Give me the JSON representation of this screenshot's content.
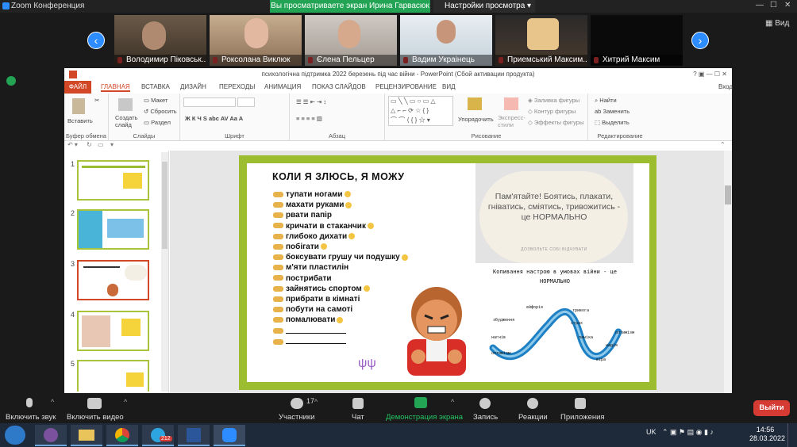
{
  "zoom_title": "Zoom Конференция",
  "share_banner": "Вы просматриваете экран Ирина Гарвасюк",
  "view_options": "Настройки просмотра",
  "view_toggle": "Вид",
  "participants": [
    {
      "name": "Володимир Піковськ..."
    },
    {
      "name": "Роксолана Виклюк"
    },
    {
      "name": "Єлена Пельцер"
    },
    {
      "name": "Вадим Украінець"
    },
    {
      "name": "Приемський Максим..."
    },
    {
      "name": "Хитрий Максим"
    }
  ],
  "ppt": {
    "title": "психологічна підтримка 2022 березень під час війни - PowerPoint (Сбой активации продукта)",
    "tabs": [
      "ФАЙЛ",
      "ГЛАВНАЯ",
      "ВСТАВКА",
      "ДИЗАЙН",
      "ПЕРЕХОДЫ",
      "АНИМАЦИЯ",
      "ПОКАЗ СЛАЙДОВ",
      "РЕЦЕНЗИРОВАНИЕ",
      "ВИД"
    ],
    "signin": "Вход",
    "ribbon": {
      "paste": "Вставить",
      "clipboard": "Буфер обмена",
      "new_slide": "Создать слайд",
      "layout": "Макет",
      "reset": "Сбросить",
      "section": "Раздел",
      "slides": "Слайды",
      "font": "Шрифт",
      "paragraph": "Абзац",
      "arrange": "Упорядочить",
      "quick_styles": "Экспресс-стили",
      "drawing": "Рисование",
      "fill": "Заливка фигуры",
      "outline": "Контур фигуры",
      "effects": "Эффекты фигуры",
      "find": "Найти",
      "replace": "Заменить",
      "select": "Выделить",
      "editing": "Редактирование"
    },
    "slide_numbers": [
      "1",
      "2",
      "3",
      "4",
      "5"
    ],
    "slide": {
      "heading": "КОЛИ Я ЗЛЮСЬ, Я МОЖУ",
      "items": [
        "тупати ногами",
        "махати руками",
        "рвати папір",
        "кричати в стаканчик",
        "глибоко дихати",
        "побігати",
        "боксувати грушу чи подушку",
        "м'яти пластилін",
        "пострибати",
        "зайнятись спортом",
        "прибрати в кімнаті",
        "побути на самоті",
        "помалювати",
        "",
        ""
      ],
      "remember": "Пам'ятайте! Боятись, плакати, гніватись, сміятись, тривожитись - це НОРМАЛЬНО",
      "allow": "ДОЗВОЛЬТЕ СОБІ ВІДЧУВАТИ",
      "copy": "Копивання настрою в умовах війни - це НОРМАЛЬНО",
      "wave_labels": [
        "ейфорія",
        "тривога",
        "збудження",
        "страх",
        "нагнів",
        "паніка",
        "оптимізм",
        "оптимізм",
        "надія",
        "віра"
      ]
    }
  },
  "toolbar": {
    "mute": "Включить звук",
    "video": "Включить видео",
    "participants": "Участники",
    "participants_count": "17",
    "chat": "Чат",
    "share": "Демонстрация экрана",
    "record": "Запись",
    "reactions": "Реакции",
    "apps": "Приложения",
    "leave": "Выйти"
  },
  "taskbar": {
    "lang": "UK",
    "time": "14:56",
    "date": "28.03.2022",
    "badge": "212"
  }
}
